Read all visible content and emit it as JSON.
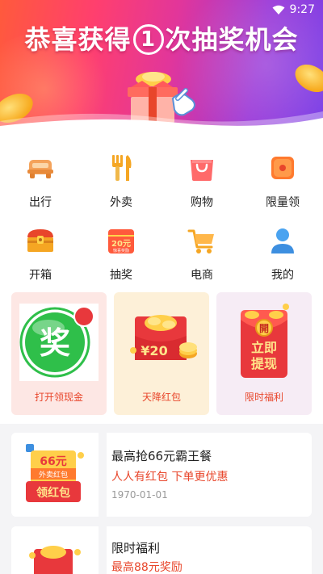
{
  "status_bar": {
    "time": "9:27",
    "wifi_icon": "wifi-icon"
  },
  "banner": {
    "title_before": "恭喜获得",
    "count_badge": "1",
    "title_after": "次抽奖机会",
    "gradient_colors": [
      "#ff5a3c",
      "#e2369a",
      "#7a3de6"
    ]
  },
  "menu": [
    {
      "label": "出行",
      "icon": "car-icon"
    },
    {
      "label": "外卖",
      "icon": "fork-knife-icon"
    },
    {
      "label": "购物",
      "icon": "shopping-bag-icon"
    },
    {
      "label": "限量领",
      "icon": "limited-coupon-icon"
    },
    {
      "label": "开箱",
      "icon": "treasure-chest-icon"
    },
    {
      "label": "抽奖",
      "icon": "lottery-icon",
      "icon_text": "20元",
      "icon_subtext": "惊喜奖励"
    },
    {
      "label": "电商",
      "icon": "shopping-cart-icon"
    },
    {
      "label": "我的",
      "icon": "user-icon"
    }
  ],
  "promo_cards": [
    {
      "label": "打开领现金",
      "icon": "prize-ball-icon",
      "badge_text": "奖",
      "bg": "#fde7e4",
      "label_color": "#e8462b"
    },
    {
      "label": "天降红包",
      "icon": "red-envelope-coins-icon",
      "amount": "¥20",
      "bg": "#fdf0d8",
      "label_color": "#e8462b"
    },
    {
      "label": "限时福利",
      "icon": "open-envelope-icon",
      "seal_text": "開",
      "lines": [
        "立即",
        "提现"
      ],
      "bg": "#f6ecf5",
      "label_color": "#e8462b"
    }
  ],
  "news": [
    {
      "title": "最高抢66元霸王餐",
      "subtitle": "人人有红包 下单更优惠",
      "date": "1970-01-01",
      "thumb": {
        "amount": "66元",
        "tag": "外卖红包",
        "cta": "领红包"
      }
    },
    {
      "title": "限时福利",
      "subtitle": "最高88元奖励",
      "date": ""
    }
  ],
  "accent_color": "#e8462b"
}
